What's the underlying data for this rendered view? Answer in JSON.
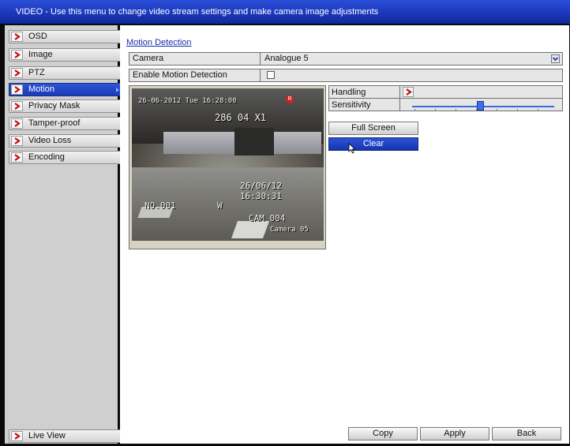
{
  "window": {
    "title": "VIDEO - Use this menu to change video stream settings and make camera image adjustments"
  },
  "sidebar": {
    "items": [
      {
        "label": "OSD"
      },
      {
        "label": "Image"
      },
      {
        "label": "PTZ"
      },
      {
        "label": "Motion",
        "active": true
      },
      {
        "label": "Privacy Mask"
      },
      {
        "label": "Tamper-proof"
      },
      {
        "label": "Video Loss"
      },
      {
        "label": "Encoding"
      }
    ],
    "footer_label": "Live View"
  },
  "main": {
    "section_title": "Motion Detection",
    "camera_label": "Camera",
    "camera_value": "Analogue 5",
    "enable_label": "Enable Motion Detection",
    "enable_checked": false,
    "handling_label": "Handling",
    "sensitivity_label": "Sensitivity",
    "sensitivity_level": 0.48,
    "full_screen_label": "Full Screen",
    "clear_label": "Clear"
  },
  "video": {
    "datetime_overlay": "26-06-2012 Tue 16:28:00",
    "top_overlay": "286  04 X1",
    "stamp_date": "26/06/12",
    "stamp_time": "16:30:31",
    "no_label": "NO.001",
    "w_label": "W",
    "cam_label": "CAM 004",
    "camera_name": "Camera 05",
    "record_badge": "R"
  },
  "footer_buttons": {
    "copy": "Copy",
    "apply": "Apply",
    "back": "Back"
  },
  "colors": {
    "title_bar": "#1a36b8",
    "active_item": "#2d54d8",
    "link_text": "#1b2fa8",
    "record_badge": "#d62020"
  }
}
